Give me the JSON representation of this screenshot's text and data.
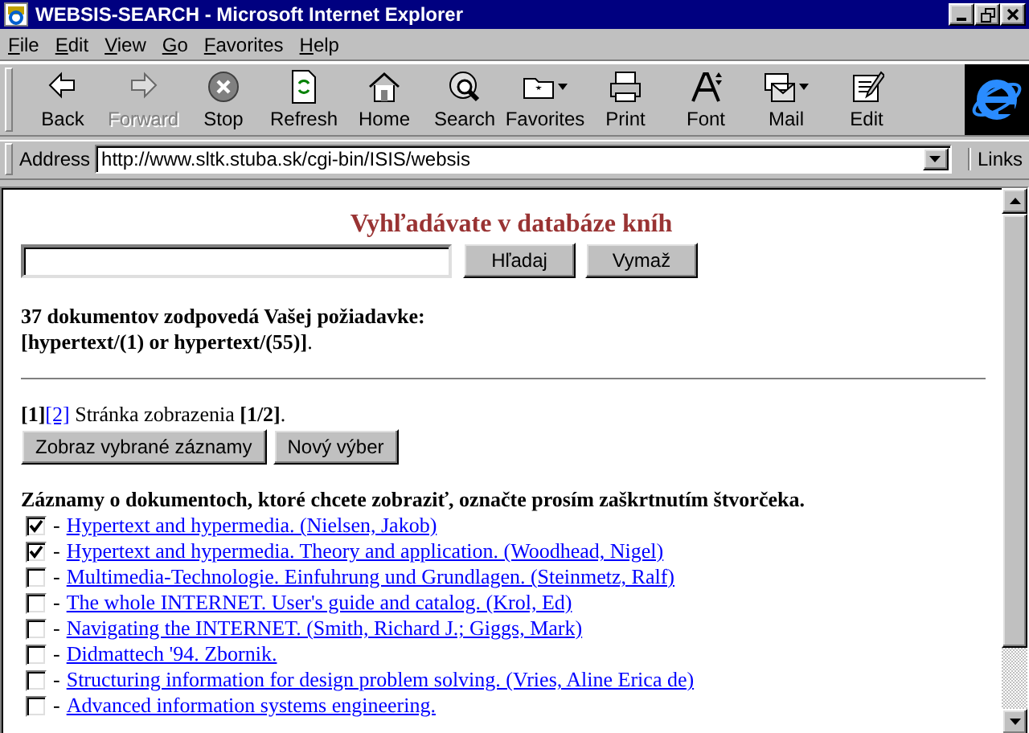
{
  "window": {
    "title": "WEBSIS-SEARCH - Microsoft Internet Explorer"
  },
  "menu": [
    "File",
    "Edit",
    "View",
    "Go",
    "Favorites",
    "Help"
  ],
  "toolbar": [
    {
      "kind": "back",
      "label": "Back",
      "disabled": false
    },
    {
      "kind": "forward",
      "label": "Forward",
      "disabled": true
    },
    {
      "kind": "stop",
      "label": "Stop",
      "disabled": false
    },
    {
      "kind": "refresh",
      "label": "Refresh",
      "disabled": false
    },
    {
      "kind": "home",
      "label": "Home",
      "disabled": false
    },
    {
      "kind": "search",
      "label": "Search",
      "disabled": false
    },
    {
      "kind": "favorites",
      "label": "Favorites",
      "disabled": false
    },
    {
      "kind": "print",
      "label": "Print",
      "disabled": false
    },
    {
      "kind": "font",
      "label": "Font",
      "disabled": false
    },
    {
      "kind": "mail",
      "label": "Mail",
      "disabled": false
    },
    {
      "kind": "edit",
      "label": "Edit",
      "disabled": false
    }
  ],
  "address_bar": {
    "label": "Address",
    "value": "http://www.sltk.stuba.sk/cgi-bin/ISIS/websis",
    "links": "Links"
  },
  "page": {
    "heading": "Vyhľadávate v databáze kníh",
    "search_buttons": [
      "Hľadaj",
      "Vymaž"
    ],
    "result_count": "37 dokumentov zodpovedá Vašej požiadavke:",
    "query": "**[hypertext/(1) or hypertext/(55)]**.",
    "pages": [
      {
        "label": "[1]",
        "selected": true
      },
      {
        "label": "[2]",
        "selected": false
      }
    ],
    "page_status": "Stránka zobrazenia **[1/2]**.",
    "action_buttons": [
      "Zobraz vybrané záznamy",
      "Nový výber"
    ],
    "instruction": "Záznamy o dokumentoch, ktoré chcete zobraziť, označte prosím zaškrtnutím štvorčeka.",
    "separator": "-",
    "records": [
      {
        "title": "Hypertext and hypermedia. (Nielsen, Jakob)",
        "checked": true
      },
      {
        "title": "Hypertext and hypermedia. Theory and application. (Woodhead, Nigel)",
        "checked": true
      },
      {
        "title": "Multimedia-Technologie. Einfuhrung und Grundlagen. (Steinmetz, Ralf)",
        "checked": false
      },
      {
        "title": "The whole INTERNET. User's guide and catalog. (Krol, Ed)",
        "checked": false
      },
      {
        "title": "Navigating the INTERNET. (Smith, Richard J.; Giggs, Mark)",
        "checked": false
      },
      {
        "title": "Didmattech '94. Zbornik.",
        "checked": false
      },
      {
        "title": "Structuring information for design problem solving. (Vries, Aline Erica de)",
        "checked": false
      },
      {
        "title": "Advanced information systems engineering.",
        "checked": false
      }
    ]
  }
}
